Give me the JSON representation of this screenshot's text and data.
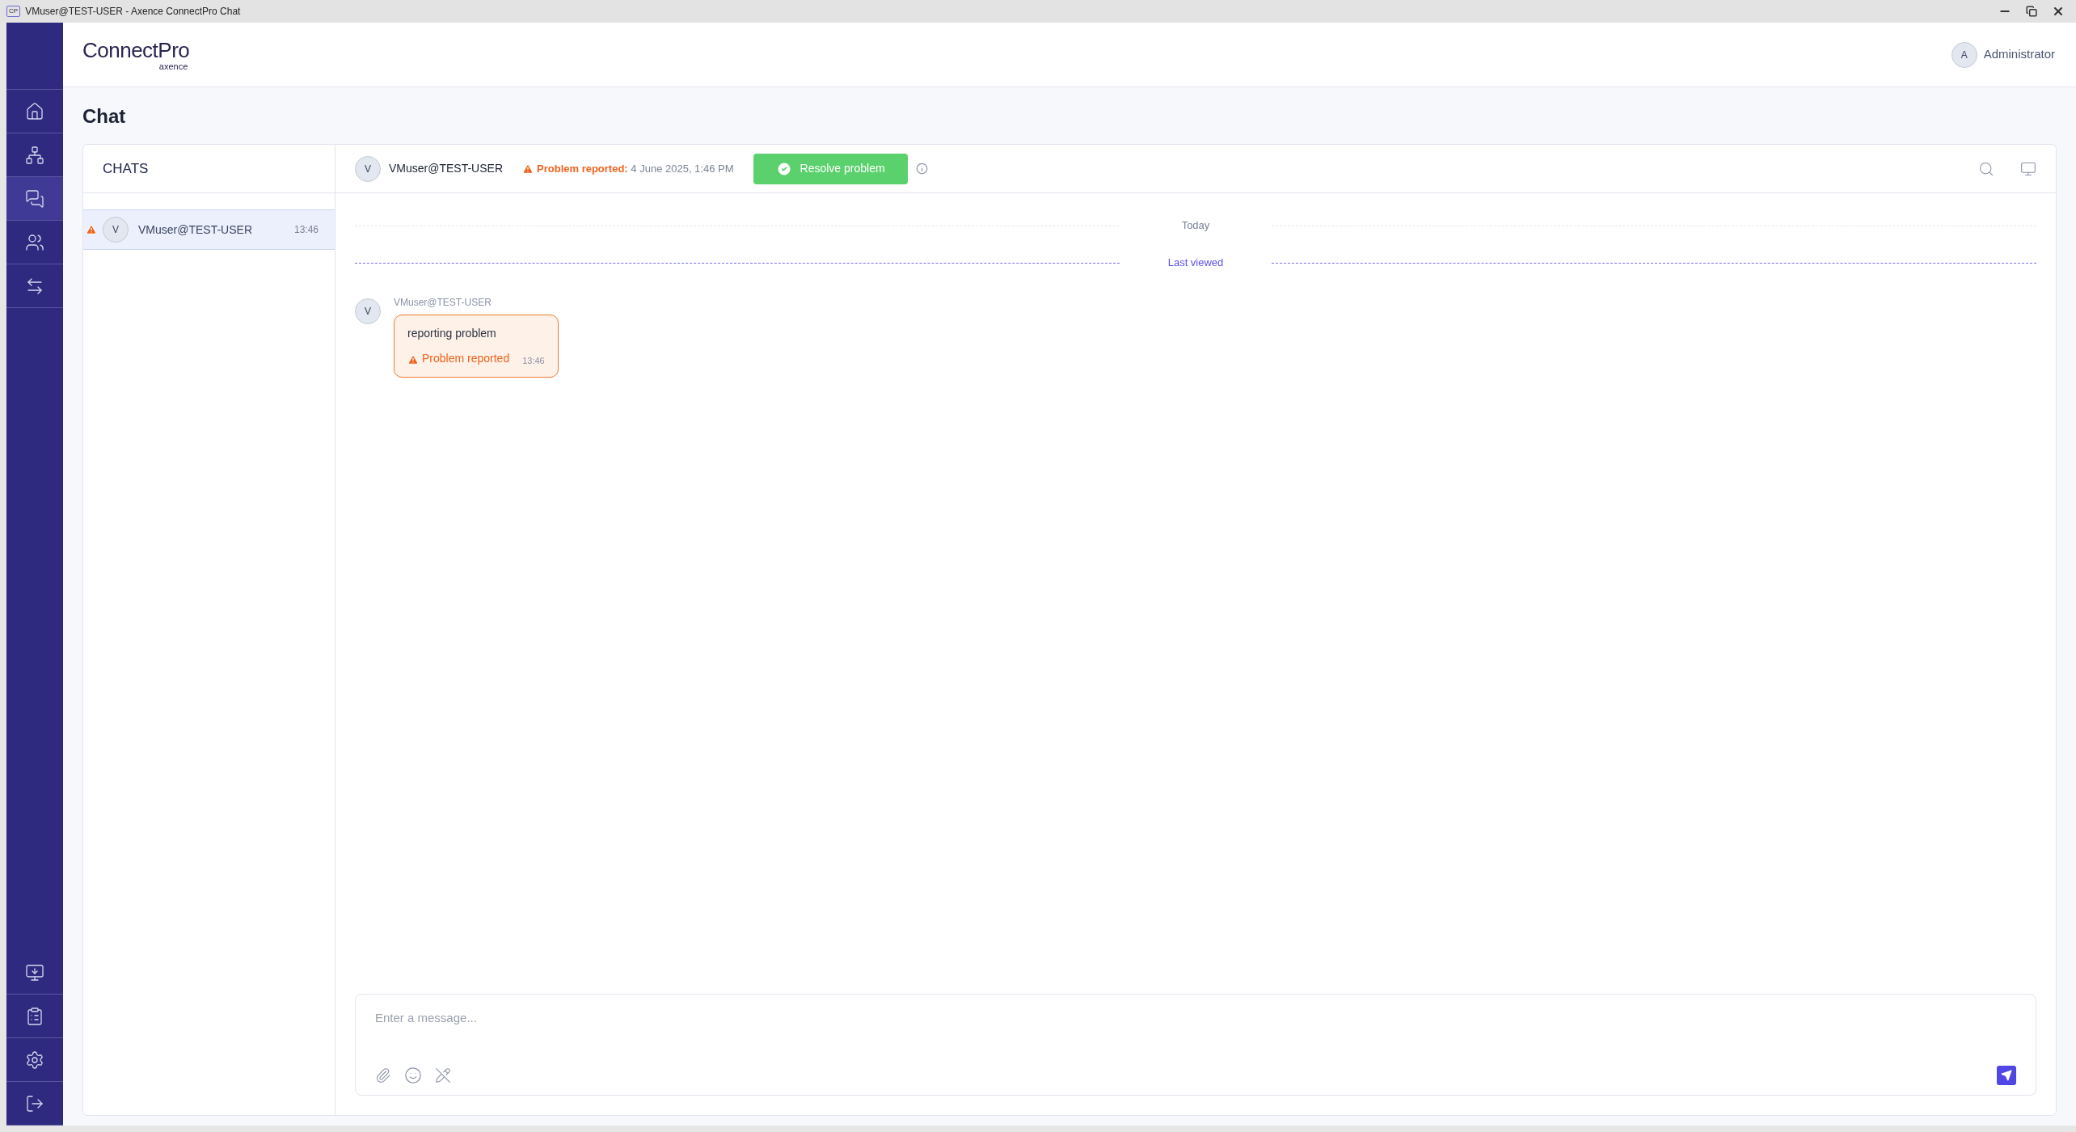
{
  "window": {
    "icon_text": "CP",
    "title": "VMuser@TEST-USER - Axence ConnectPro Chat"
  },
  "logo": {
    "name": "ConnectPro",
    "sub": "axence"
  },
  "user": {
    "initial": "A",
    "name": "Administrator"
  },
  "nav": {
    "top": [
      {
        "kind": "home",
        "selected": false
      },
      {
        "kind": "devices",
        "selected": false
      },
      {
        "kind": "chat",
        "selected": true
      },
      {
        "kind": "users",
        "selected": false
      },
      {
        "kind": "transfer",
        "selected": false
      }
    ],
    "bottom": [
      {
        "kind": "download",
        "selected": false
      },
      {
        "kind": "clipboard",
        "selected": false
      },
      {
        "kind": "settings",
        "selected": false
      },
      {
        "kind": "logout",
        "selected": false
      }
    ]
  },
  "page_title": "Chat",
  "chats": {
    "title": "CHATS",
    "items": [
      {
        "initial": "V",
        "name": "VMuser@TEST-USER",
        "time": "13:46",
        "alert": true,
        "selected": true
      }
    ]
  },
  "conversation": {
    "initial": "V",
    "name": "VMuser@TEST-USER",
    "status_label": "Problem reported:",
    "status_date": "4 June 2025, 1:46 PM",
    "resolve_button": "Resolve problem"
  },
  "dividers": [
    {
      "kind": "date",
      "label": "Today"
    },
    {
      "kind": "last_viewed",
      "label": "Last viewed"
    }
  ],
  "messages": [
    {
      "initial": "V",
      "sender": "VMuser@TEST-USER",
      "text": "reporting problem",
      "flag": "Problem reported",
      "time": "13:46"
    }
  ],
  "composer": {
    "placeholder": "Enter a message..."
  }
}
